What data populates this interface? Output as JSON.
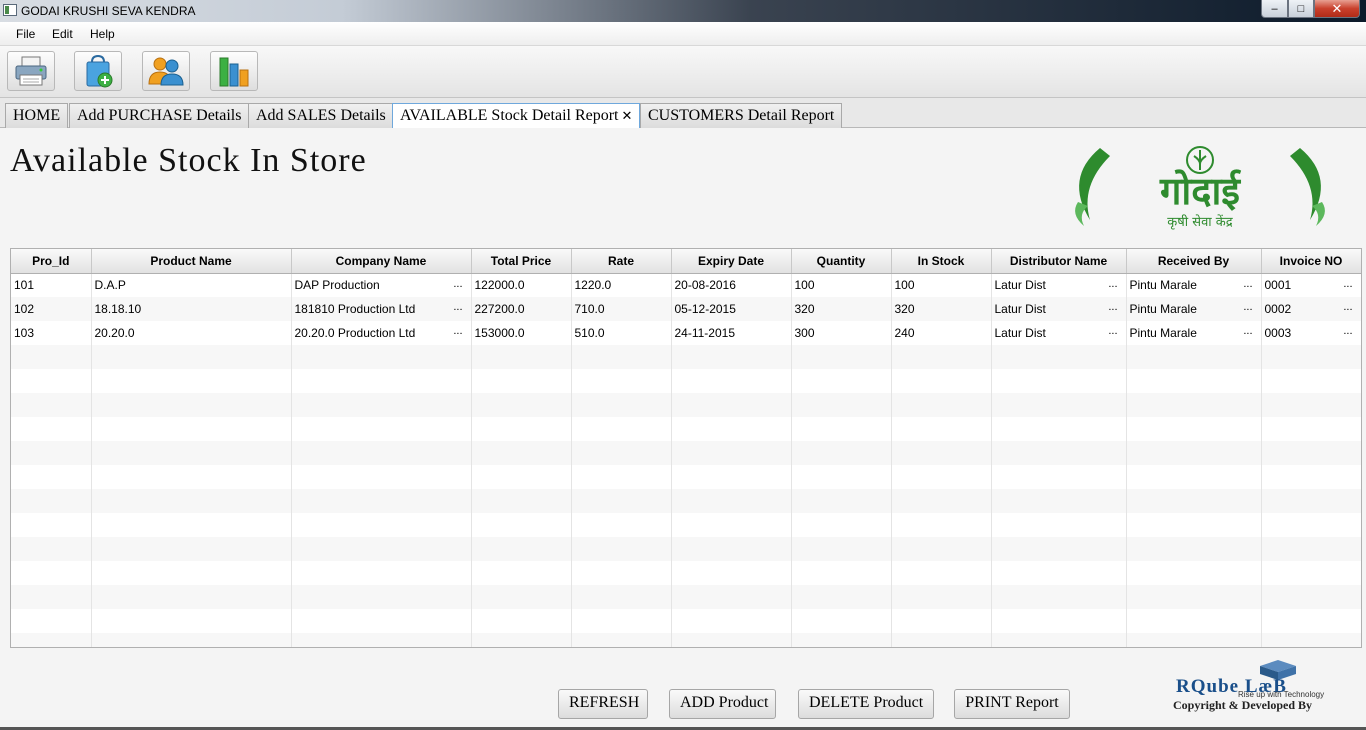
{
  "window": {
    "title": "GODAI KRUSHI SEVA KENDRA",
    "min": "–",
    "max": "□",
    "close": "✕"
  },
  "menu": [
    "File",
    "Edit",
    "Help"
  ],
  "toolbar": [
    {
      "icon": "printer-icon"
    },
    {
      "icon": "shopping-bag-add-icon"
    },
    {
      "icon": "users-icon"
    },
    {
      "icon": "bar-chart-icon"
    }
  ],
  "tabs": [
    {
      "label": "HOME"
    },
    {
      "label": "Add PURCHASE Details"
    },
    {
      "label": "Add SALES Details"
    },
    {
      "label": "AVAILABLE Stock Detail Report",
      "active": true,
      "close": "✕"
    },
    {
      "label": "CUSTOMERS Detail Report"
    }
  ],
  "page": {
    "heading": "Available Stock In Store",
    "logo": {
      "main": "गोदाई",
      "sub": "कृषी सेवा केंद्र"
    }
  },
  "table": {
    "columns": [
      "Pro_Id",
      "Product Name",
      "Company Name",
      "Total Price",
      "Rate",
      "Expiry Date",
      "Quantity",
      "In Stock",
      "Distributor Name",
      "Received By",
      "Invoice NO"
    ],
    "rows": [
      [
        "101",
        "D.A.P",
        "DAP Production",
        "122000.0",
        "1220.0",
        "20-08-2016",
        "100",
        "100",
        "Latur Dist",
        "Pintu Marale",
        "0001"
      ],
      [
        "102",
        "18.18.10",
        "181810 Production Ltd",
        "227200.0",
        "710.0",
        "05-12-2015",
        "320",
        "320",
        "Latur Dist",
        "Pintu Marale",
        "0002"
      ],
      [
        "103",
        "20.20.0",
        "20.20.0 Production Ltd",
        "153000.0",
        "510.0",
        "24-11-2015",
        "300",
        "240",
        "Latur Dist",
        "Pintu Marale",
        "0003"
      ]
    ],
    "truncated_columns": [
      2,
      8,
      9,
      10
    ],
    "ellipsis": "..."
  },
  "buttons": {
    "refresh": "REFRESH",
    "add": "ADD Product",
    "delete": "DELETE Product",
    "print": "PRINT Report"
  },
  "credit": {
    "brand": "RQube LæB",
    "tagline": "Rise up with Technology",
    "developed": "Copyright & Developed By"
  },
  "colors": {
    "logo_green": "#2e8b2e",
    "brand_blue": "#1a4f8a",
    "active_tab_border": "#6fa8dc"
  }
}
